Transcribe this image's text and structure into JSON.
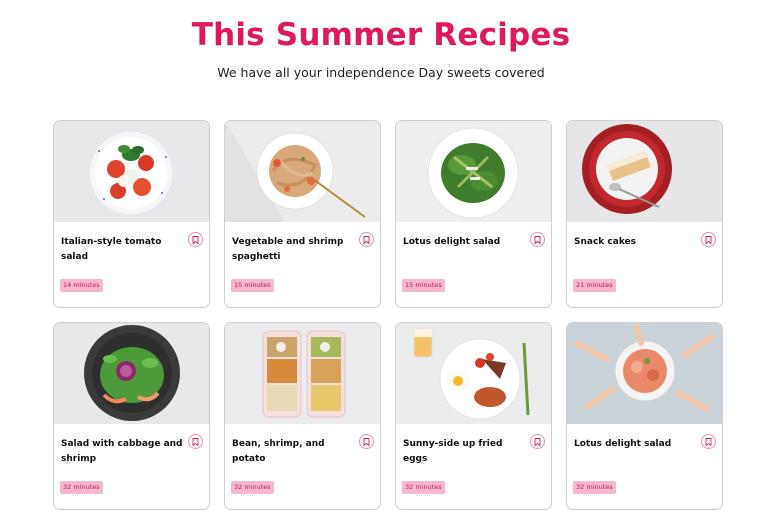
{
  "header": {
    "title": "This Summer Recipes",
    "subtitle": "We have all your independence Day sweets covered"
  },
  "recipes": [
    {
      "title": "Italian-style tomato salad",
      "time": "14 minutes",
      "photo": "tomato-salad-plate"
    },
    {
      "title": "Vegetable and shrimp spaghetti",
      "time": "15 minutes",
      "photo": "spaghetti-plate"
    },
    {
      "title": "Lotus delight salad",
      "time": "15 minutes",
      "photo": "asparagus-salad-plate"
    },
    {
      "title": "Snack cakes",
      "time": "21 minutes",
      "photo": "cake-slice-plate"
    },
    {
      "title": "Salad with cabbage and shrimp",
      "time": "32 minutes",
      "photo": "cabbage-shrimp-bowl"
    },
    {
      "title": "Bean, shrimp, and potato",
      "time": "32 minutes",
      "photo": "meal-prep-containers"
    },
    {
      "title": "Sunny-side up fried eggs",
      "time": "32 minutes",
      "photo": "breakfast-plate"
    },
    {
      "title": "Lotus delight salad",
      "time": "32 minutes",
      "photo": "shared-salad-plate"
    }
  ],
  "icons": {
    "bookmark": "bookmark-icon"
  },
  "colors": {
    "accent": "#e0195d",
    "badge_bg": "#f7b7cf",
    "badge_text": "#c2185b"
  }
}
